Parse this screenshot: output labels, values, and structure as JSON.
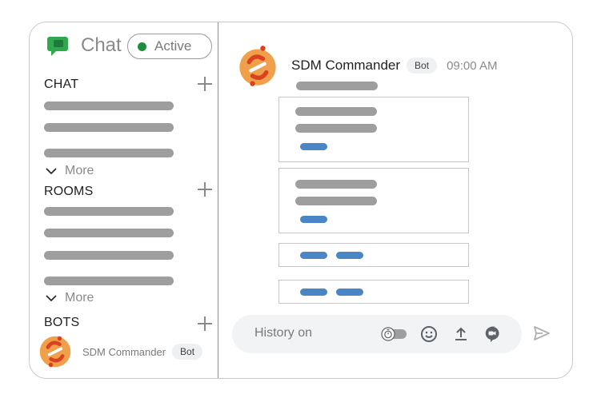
{
  "app": {
    "title": "Chat",
    "status": "Active",
    "status_color": "#1e8e3e"
  },
  "sidebar": {
    "sections": [
      {
        "key": "chat",
        "label": "CHAT",
        "more_label": "More"
      },
      {
        "key": "rooms",
        "label": "ROOMS",
        "more_label": "More"
      },
      {
        "key": "bots",
        "label": "BOTS"
      }
    ],
    "bot_entry": {
      "name": "SDM Commander",
      "tag": "Bot"
    }
  },
  "message": {
    "sender": "SDM Commander",
    "tag": "Bot",
    "time": "09:00 AM"
  },
  "composer": {
    "placeholder": "History on"
  },
  "colors": {
    "accent_blue": "#4a86c5",
    "placeholder_gray": "#9e9e9e",
    "logo_orange": "#f0a04b",
    "logo_red": "#d9421f",
    "chat_icon_green": "#2fa84f"
  },
  "icons": {
    "brand": "google-chat-icon",
    "add": "plus-icon",
    "more": "chevron-down-icon",
    "avatar": "sdm-logo-icon",
    "history": "timer-toggle-icon",
    "emoji": "emoji-icon",
    "upload": "upload-icon",
    "video": "video-meet-icon",
    "send": "send-icon"
  }
}
